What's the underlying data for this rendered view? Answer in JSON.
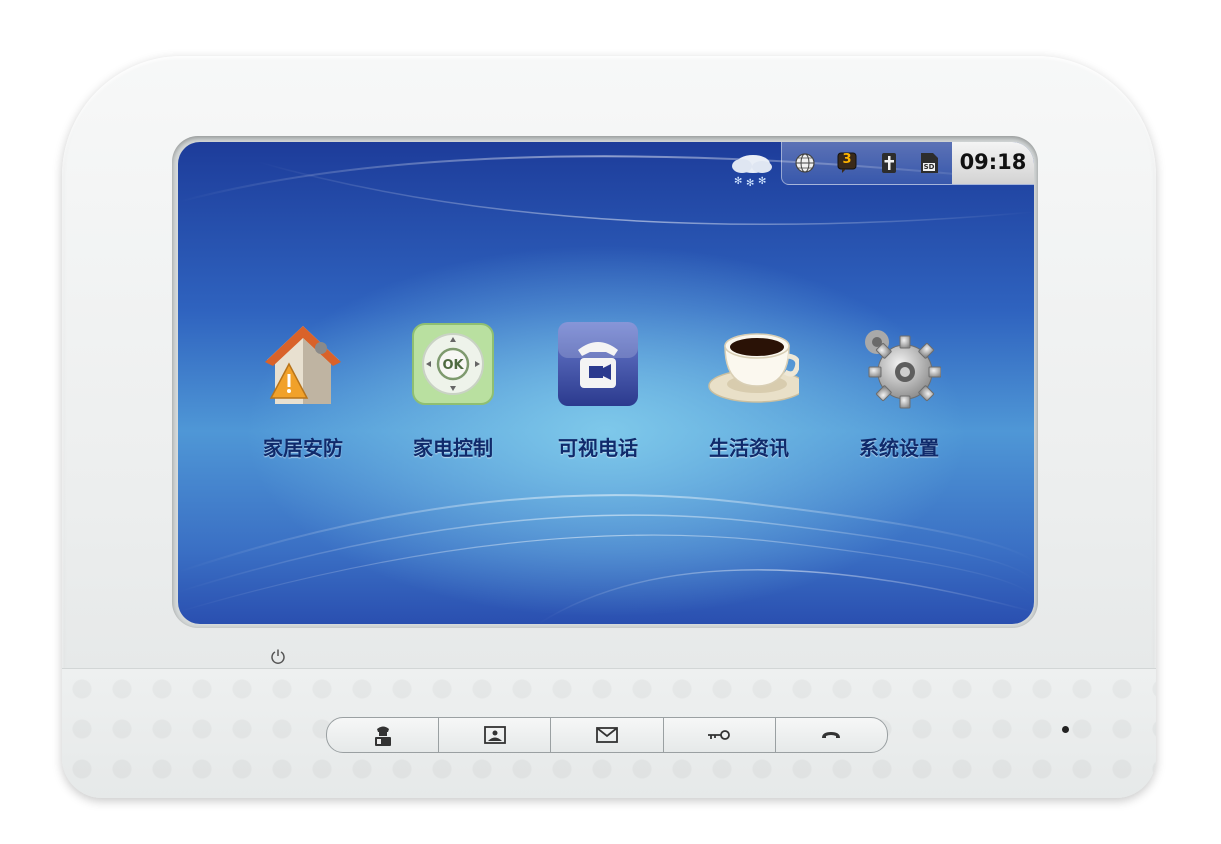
{
  "status": {
    "time": "09:18",
    "badge_count": "3",
    "sd_label": "SD",
    "icons": [
      "weather-snow-cloud-icon",
      "globe-icon",
      "message-badge-icon",
      "cross-icon",
      "sd-card-icon"
    ]
  },
  "apps": [
    {
      "label": "家居安防",
      "icon": "home-alarm-icon"
    },
    {
      "label": "家电控制",
      "icon": "remote-control-icon",
      "icon_text": "OK"
    },
    {
      "label": "可视电话",
      "icon": "video-phone-icon"
    },
    {
      "label": "生活资讯",
      "icon": "coffee-cup-icon"
    },
    {
      "label": "系统设置",
      "icon": "gear-icon"
    }
  ],
  "hardware_buttons": [
    "guard-icon",
    "picture-icon",
    "mail-icon",
    "key-icon",
    "hangup-icon"
  ],
  "colors": {
    "accent": "#2f63bf",
    "label": "#102a6b",
    "bezel": "#eceeee"
  }
}
